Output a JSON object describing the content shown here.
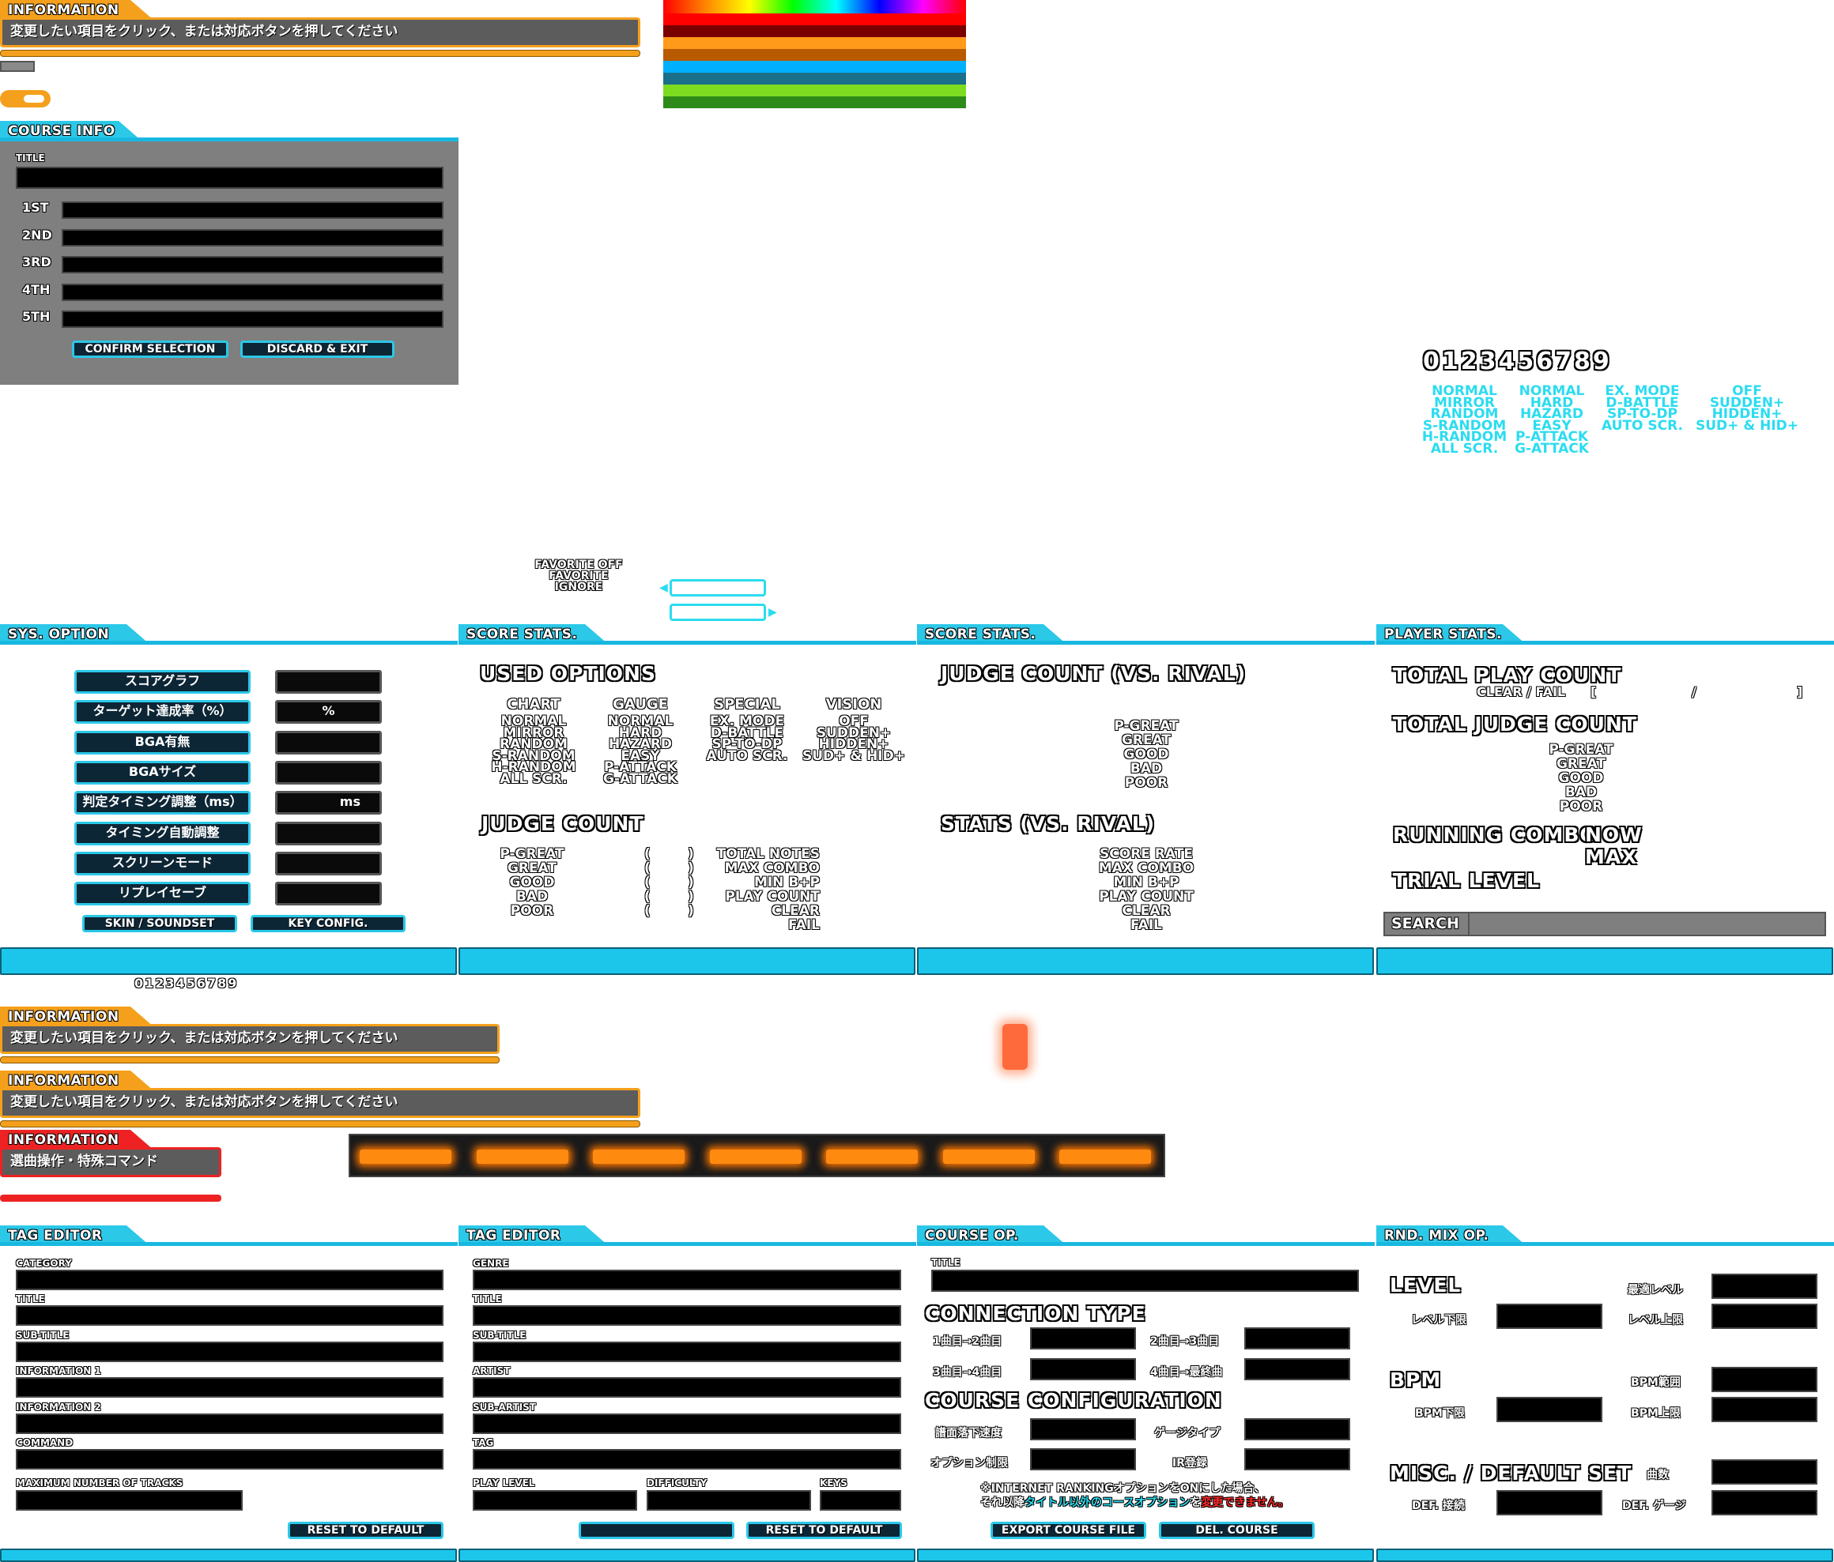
{
  "info": {
    "tab": "INFORMATION",
    "message": "変更したい項目をクリック、または対応ボタンを押してください"
  },
  "info2": {
    "tab": "INFORMATION",
    "message": "変更したい項目をクリック、または対応ボタンを押してください"
  },
  "info3": {
    "tab": "INFORMATION",
    "message": "変更したい項目をクリック、または対応ボタンを押してください"
  },
  "info4": {
    "tab": "INFORMATION",
    "message": "選曲操作・特殊コマンド"
  },
  "palette": {
    "colors": [
      "#ff0000",
      "#7a0000",
      "#ff9a1a",
      "#b85a00",
      "#00b0ff",
      "#1a6f8a",
      "#7ddc1f",
      "#2e8b1a"
    ]
  },
  "course_info": {
    "tab": "COURSE INFO",
    "title_label": "TITLE",
    "slots": [
      "1ST",
      "2ND",
      "3RD",
      "4TH",
      "5TH"
    ],
    "confirm": "CONFIRM SELECTION",
    "discard": "DISCARD & EXIT"
  },
  "digits": "0123456789",
  "digits_small": "0123456789",
  "option_lists": {
    "chart": [
      "NORMAL",
      "MIRROR",
      "RANDOM",
      "S-RANDOM",
      "H-RANDOM",
      "ALL SCR."
    ],
    "gauge": [
      "NORMAL",
      "HARD",
      "HAZARD",
      "EASY",
      "P-ATTACK",
      "G-ATTACK"
    ],
    "special": [
      "EX. MODE",
      "D-BATTLE",
      "SP-TO-DP",
      "AUTO SCR."
    ],
    "vision": [
      "OFF",
      "SUDDEN+",
      "HIDDEN+",
      "SUD+ & HID+"
    ]
  },
  "favorite": [
    "FAVORITE OFF",
    "FAVORITE",
    "IGNORE"
  ],
  "sys_option": {
    "tab": "SYS. OPTION",
    "items": [
      {
        "label": "スコアグラフ",
        "value": ""
      },
      {
        "label": "ターゲット達成率（%）",
        "value": "%"
      },
      {
        "label": "BGA有無",
        "value": ""
      },
      {
        "label": "BGAサイズ",
        "value": ""
      },
      {
        "label": "判定タイミング調整（ms）",
        "value": "ms"
      },
      {
        "label": "タイミング自動調整",
        "value": ""
      },
      {
        "label": "スクリーンモード",
        "value": ""
      },
      {
        "label": "リプレイセーブ",
        "value": ""
      }
    ],
    "skin_btn": "SKIN / SOUNDSET",
    "key_btn": "KEY CONFIG."
  },
  "score_stats": {
    "tab": "SCORE STATS.",
    "used_options": "USED OPTIONS",
    "headers": [
      "CHART",
      "GAUGE",
      "SPECIAL",
      "VISION"
    ],
    "judge_count": "JUDGE COUNT",
    "judges": [
      "P-GREAT",
      "GREAT",
      "GOOD",
      "BAD",
      "POOR"
    ],
    "paren_open": "(",
    "paren_close": ")",
    "stats": [
      "TOTAL NOTES",
      "MAX COMBO",
      "MIN B+P",
      "PLAY COUNT",
      "CLEAR",
      "FAIL"
    ]
  },
  "score_stats2": {
    "tab": "SCORE STATS.",
    "judge_vs": "JUDGE COUNT (VS. RIVAL)",
    "judges": [
      "P-GREAT",
      "GREAT",
      "GOOD",
      "BAD",
      "POOR"
    ],
    "stats_vs": "STATS (VS. RIVAL)",
    "stats": [
      "SCORE RATE",
      "MAX COMBO",
      "MIN B+P",
      "PLAY COUNT",
      "CLEAR",
      "FAIL"
    ]
  },
  "player_stats": {
    "tab": "PLAYER STATS.",
    "total_play": "TOTAL PLAY COUNT",
    "clear_fail": "CLEAR / FAIL",
    "bracket_open": "[",
    "slash": "/",
    "bracket_close": "]",
    "total_judge": "TOTAL JUDGE COUNT",
    "judges": [
      "P-GREAT",
      "GREAT",
      "GOOD",
      "BAD",
      "POOR"
    ],
    "running": "RUNNING COMBO",
    "now": "NOW",
    "max": "MAX",
    "trial": "TRIAL LEVEL",
    "search": "SEARCH"
  },
  "tag_editor1": {
    "tab": "TAG EDITOR",
    "fields": [
      "CATEGORY",
      "TITLE",
      "SUB-TITLE",
      "INFORMATION 1",
      "INFORMATION 2",
      "COMMAND"
    ],
    "max_tracks": "MAXIMUM NUMBER OF TRACKS",
    "reset": "RESET TO DEFAULT"
  },
  "tag_editor2": {
    "tab": "TAG EDITOR",
    "fields": [
      "GENRE",
      "TITLE",
      "SUB-TITLE",
      "ARTIST",
      "SUB-ARTIST",
      "TAG"
    ],
    "play_level": "PLAY LEVEL",
    "difficulty": "DIFFICULTY",
    "keys": "KEYS",
    "reset": "RESET TO DEFAULT"
  },
  "course_op": {
    "tab": "COURSE OP.",
    "title_label": "TITLE",
    "connection": "CONNECTION TYPE",
    "conn_labels": [
      "1曲目→2曲目",
      "2曲目→3曲目",
      "3曲目→4曲目",
      "4曲目→最終曲"
    ],
    "config": "COURSE CONFIGURATION",
    "cfg_labels": [
      "譜面落下速度",
      "ゲージタイプ",
      "オプション制限",
      "IR登録"
    ],
    "note1": "※INTERNET RANKINGオプションをONにした場合、",
    "note2a": "それ以降",
    "note2b": "タイトル以外のコースオプション",
    "note2c": "を",
    "note2d": "変更できません。",
    "export": "EXPORT COURSE FILE",
    "del": "DEL. COURSE"
  },
  "rnd_mix": {
    "tab": "RND. MIX OP.",
    "level": "LEVEL",
    "lvl_labels": [
      "最適レベル",
      "レベル下限",
      "レベル上限"
    ],
    "bpm": "BPM",
    "bpm_labels": [
      "BPM範囲",
      "BPM下限",
      "BPM上限"
    ],
    "misc": "MISC. / DEFAULT SET",
    "misc_labels": [
      "曲数",
      "DEF. 接続",
      "DEF. ゲージ"
    ]
  },
  "colors": {
    "cyan": "#2bc8e8",
    "orange": "#f4a01c",
    "red": "#ee2222",
    "panel": "#7f7f7f"
  }
}
